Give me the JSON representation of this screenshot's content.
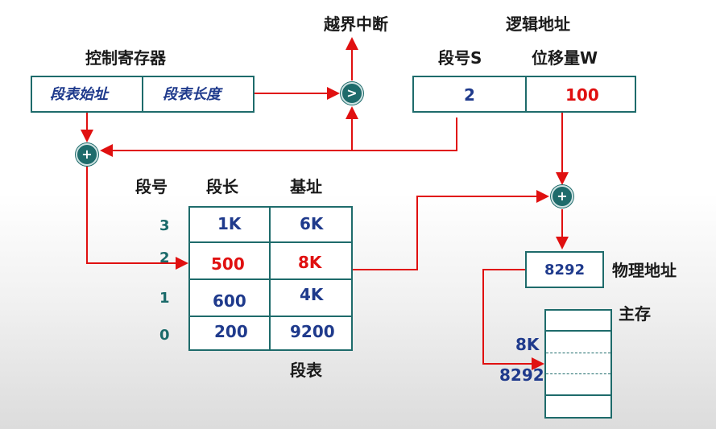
{
  "labels": {
    "control_register": "控制寄存器",
    "overflow_interrupt": "越界中断",
    "logical_address": "逻辑地址",
    "segment_no_s": "段号S",
    "offset_w": "位移量W",
    "physical_address": "物理地址",
    "main_memory": "主存",
    "segment_table": "段表"
  },
  "control_register": {
    "table_start": "段表始址",
    "table_length": "段表长度"
  },
  "logical_address": {
    "segment": "2",
    "offset": "100"
  },
  "operators": {
    "compare": ">",
    "add1": "+",
    "add2": "+"
  },
  "segment_table": {
    "headers": [
      "段号",
      "段长",
      "基址"
    ],
    "rows": [
      {
        "no": "3",
        "length": "1K",
        "base": "6K"
      },
      {
        "no": "2",
        "length": "500",
        "base": "8K"
      },
      {
        "no": "1",
        "length": "600",
        "base": "4K"
      },
      {
        "no": "0",
        "length": "200",
        "base": "9200"
      }
    ]
  },
  "physical_address_value": "8292",
  "memory_marks": {
    "mark1": "8K",
    "mark2": "8292"
  },
  "colors": {
    "wire": "#e01010",
    "border": "#1e6b6b",
    "value_blue": "#1f3a8c",
    "value_red": "#e01010"
  }
}
